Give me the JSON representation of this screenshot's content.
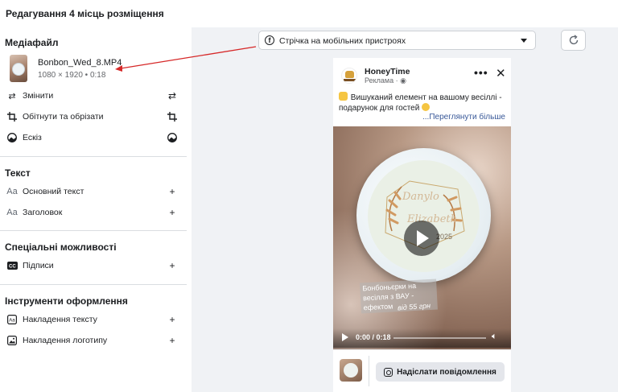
{
  "page_title": "Редагування 4 місць розміщення",
  "media_section": {
    "heading": "Медіафайл",
    "file_name": "Bonbon_Wed_8.MP4",
    "file_meta": "1080 × 1920 • 0:18",
    "actions": [
      {
        "label": "Змінити",
        "icon": "swap-icon"
      },
      {
        "label": "Обітнути та обрізати",
        "icon": "crop-icon"
      },
      {
        "label": "Ескіз",
        "icon": "thumbnail-icon"
      }
    ]
  },
  "text_section": {
    "heading": "Текст",
    "items": [
      {
        "label": "Основний текст",
        "icon": "text-size-icon"
      },
      {
        "label": "Заголовок",
        "icon": "text-size-icon"
      }
    ]
  },
  "accessibility_section": {
    "heading": "Спеціальні можливості",
    "items": [
      {
        "label": "Підписи",
        "icon": "captions-icon"
      }
    ]
  },
  "design_section": {
    "heading": "Інструменти оформлення",
    "items": [
      {
        "label": "Накладення тексту",
        "icon": "text-overlay-icon"
      },
      {
        "label": "Накладення логотипу",
        "icon": "image-overlay-icon"
      }
    ]
  },
  "preview": {
    "placement_select": "Стрічка на мобільних пристроях",
    "page_name": "HoneyTime",
    "sponsored": "Реклама · ",
    "primary_text": "Вишуканий елемент на вашому весіллі - подарунок для гостей",
    "see_more": "...Переглянути більше",
    "video_names_1": "Danylo",
    "video_names_2": "Elizabeth",
    "video_year": "2025",
    "video_caption": "Бонбоньєрки на весілля з ВАУ - ефектом",
    "video_price": "від 55 грн",
    "video_time": "0:00 / 0:18",
    "cta_label": "Надіслати повідомлення"
  },
  "colors": {
    "panel_bg": "#f0f2f5",
    "arrow": "#d62828",
    "link": "#385898"
  }
}
